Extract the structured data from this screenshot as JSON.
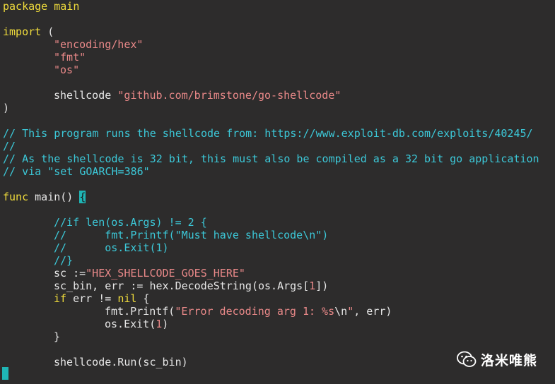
{
  "code": {
    "l1": "package main",
    "l3_kw": "import",
    "l3_rest": " (",
    "l4": "\"encoding/hex\"",
    "l5": "\"fmt\"",
    "l6": "\"os\"",
    "l8_id": "shellcode ",
    "l8_str": "\"github.com/brimstone/go-shellcode\"",
    "l9": ")",
    "l11": "// This program runs the shellcode from: https://www.exploit-db.com/exploits/40245/",
    "l12": "//",
    "l13": "// As the shellcode is 32 bit, this must also be compiled as a 32 bit go application",
    "l14": "// via \"set GOARCH=386\"",
    "l16_kw": "func",
    "l16_rest": " main() ",
    "l16_brace": "{",
    "l18": "//if len(os.Args) != 2 {",
    "l19": "//      fmt.Printf(\"Must have shellcode\\n\")",
    "l20": "//      os.Exit(1)",
    "l21": "//}",
    "l22_a": "sc :=",
    "l22_str": "\"HEX_SHELLCODE_GOES_HERE\"",
    "l23_a": "sc_bin, err := hex.DecodeString(os.Args[",
    "l23_num": "1",
    "l23_b": "])",
    "l24_kw": "if",
    "l24_a": " err != ",
    "l24_nil": "nil",
    "l24_b": " {",
    "l25_a": "fmt.Printf(",
    "l25_str1": "\"Error decoding arg 1: %s",
    "l25_esc": "\\n",
    "l25_str2": "\"",
    "l25_b": ", err)",
    "l26_a": "os.Exit(",
    "l26_num": "1",
    "l26_b": ")",
    "l27": "}",
    "l29": "shellcode.Run(sc_bin)"
  },
  "watermark": {
    "icon": "wechat-icon",
    "text": "洛米唯熊"
  }
}
